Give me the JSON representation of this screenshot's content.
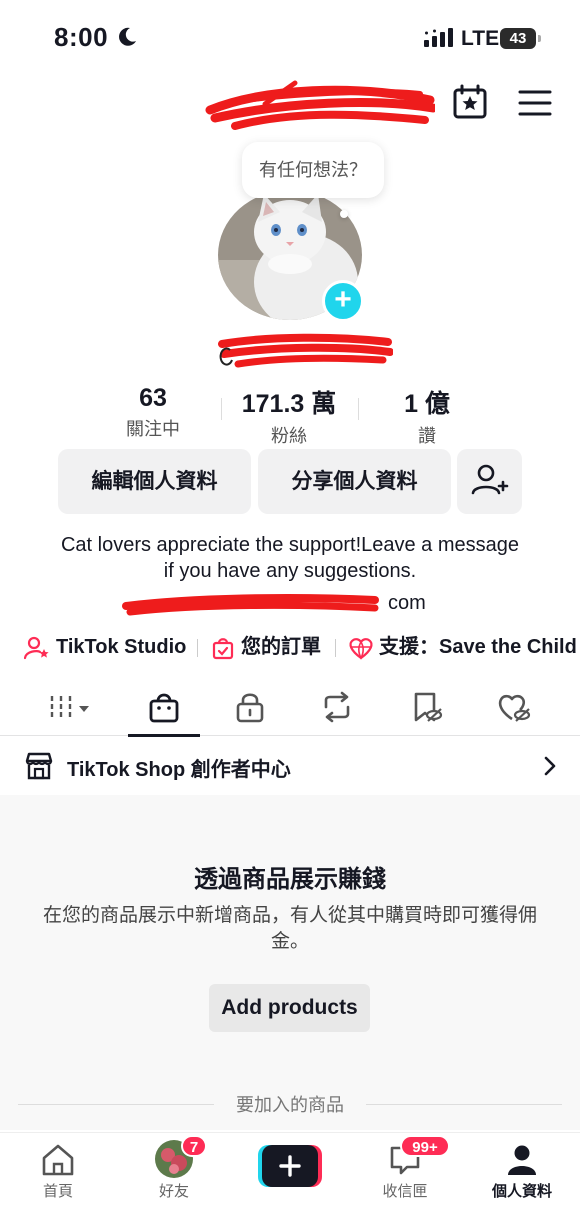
{
  "status_bar": {
    "time": "8:00",
    "network": "LTE",
    "battery": "43"
  },
  "profile": {
    "thought_bubble": "有任何想法？",
    "stats": [
      {
        "value": "63",
        "label": "關注中"
      },
      {
        "value": "171.3 萬",
        "label": "粉絲"
      },
      {
        "value": "1 億",
        "label": "讚"
      }
    ],
    "edit_button": "編輯個人資料",
    "share_button": "分享個人資料",
    "bio": "Cat lovers appreciate the support!Leave a message if you have any suggestions.",
    "email_visible": "com"
  },
  "links": {
    "studio": "TikTok Studio",
    "orders": "您的訂單",
    "support": "支援：Save the Child"
  },
  "shop": {
    "row_label": "TikTok Shop 創作者中心",
    "title": "透過商品展示賺錢",
    "description": "在您的商品展示中新增商品，有人從其中購買時即可獲得佣金。",
    "add_button": "Add products",
    "divider_label": "要加入的商品"
  },
  "bottom_nav": {
    "home": "首頁",
    "friends": "好友",
    "friends_badge": "7",
    "inbox": "收信匣",
    "inbox_badge": "99+",
    "profile": "個人資料"
  },
  "colors": {
    "accent_red": "#fe2c55",
    "accent_cyan": "#20d5ec",
    "button_bg": "#f1f1f2",
    "scribble": "#ee1c1c"
  }
}
